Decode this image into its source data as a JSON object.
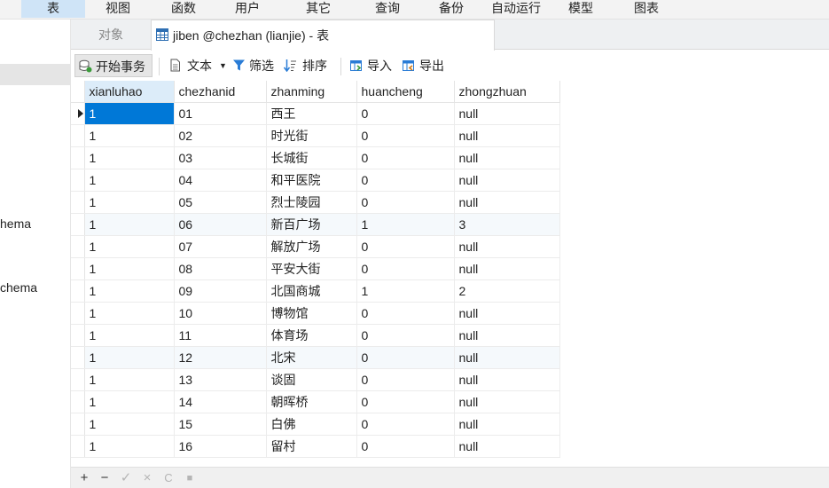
{
  "menu": [
    {
      "label": "表",
      "active": true
    },
    {
      "label": "视图"
    },
    {
      "label": "函数"
    },
    {
      "label": "用户"
    },
    {
      "label": "其它"
    },
    {
      "label": "查询"
    },
    {
      "label": "备份"
    },
    {
      "label": "自动运行"
    },
    {
      "label": "模型"
    },
    {
      "label": "图表"
    }
  ],
  "sidebar": {
    "items": [
      "hema",
      "chema"
    ]
  },
  "tabs": {
    "objects_label": "对象",
    "active_label": "jiben @chezhan (lianjie) - 表"
  },
  "toolbar": {
    "begin_transaction": "开始事务",
    "text": "文本",
    "filter": "筛选",
    "sort": "排序",
    "import": "导入",
    "export": "导出"
  },
  "grid": {
    "columns": [
      "xianluhao",
      "chezhanid",
      "zhanming",
      "huancheng",
      "zhongzhuan"
    ],
    "rows": [
      [
        "1",
        "01",
        "西王",
        "0",
        "null"
      ],
      [
        "1",
        "02",
        "时光街",
        "0",
        "null"
      ],
      [
        "1",
        "03",
        "长城街",
        "0",
        "null"
      ],
      [
        "1",
        "04",
        "和平医院",
        "0",
        "null"
      ],
      [
        "1",
        "05",
        "烈士陵园",
        "0",
        "null"
      ],
      [
        "1",
        "06",
        "新百广场",
        "1",
        "3"
      ],
      [
        "1",
        "07",
        "解放广场",
        "0",
        "null"
      ],
      [
        "1",
        "08",
        "平安大街",
        "0",
        "null"
      ],
      [
        "1",
        "09",
        "北国商城",
        "1",
        "2"
      ],
      [
        "1",
        "10",
        "博物馆",
        "0",
        "null"
      ],
      [
        "1",
        "11",
        "体育场",
        "0",
        "null"
      ],
      [
        "1",
        "12",
        "北宋",
        "0",
        "null"
      ],
      [
        "1",
        "13",
        "谈固",
        "0",
        "null"
      ],
      [
        "1",
        "14",
        "朝晖桥",
        "0",
        "null"
      ],
      [
        "1",
        "15",
        "白佛",
        "0",
        "null"
      ],
      [
        "1",
        "16",
        "留村",
        "0",
        "null"
      ]
    ]
  },
  "bottombar": {
    "add": "+",
    "remove": "−",
    "apply": "✓",
    "discard": "×",
    "refresh": "C",
    "stop": "■"
  }
}
